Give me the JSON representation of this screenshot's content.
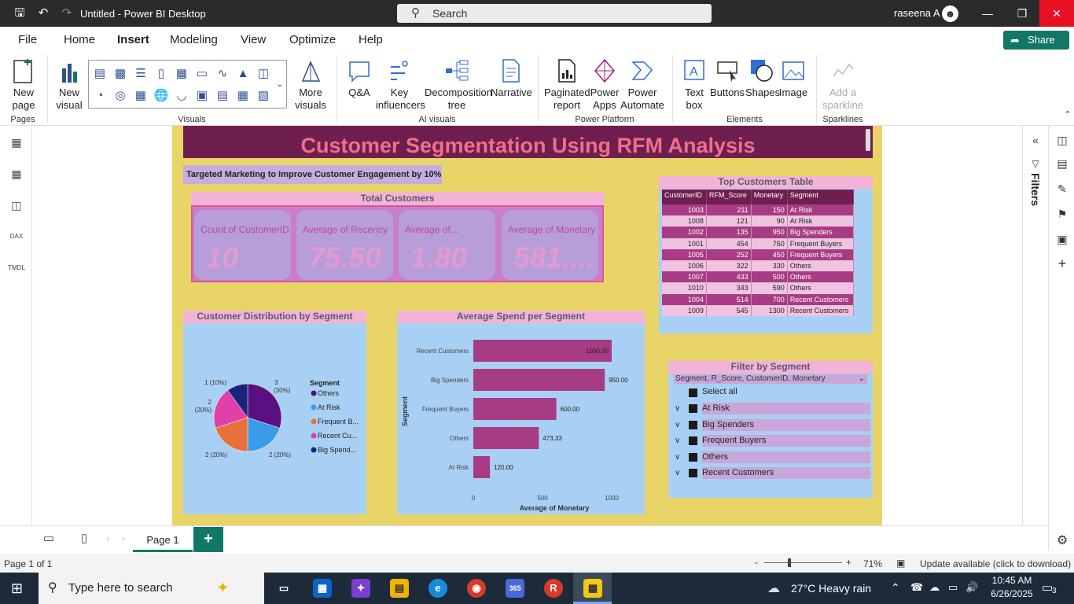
{
  "window": {
    "title": "Untitled - Power BI Desktop",
    "search_label": "Search",
    "user": "raseena A"
  },
  "menu": {
    "items": [
      "File",
      "Home",
      "Insert",
      "Modeling",
      "View",
      "Optimize",
      "Help"
    ],
    "active": "Insert",
    "share_label": "Share"
  },
  "ribbon": {
    "new_page": "New page",
    "new_visual": "New visual",
    "more_visuals": "More visuals",
    "qa": "Q&A",
    "key_influencers": "Key influencers",
    "decomposition_tree": "Decomposition tree",
    "narrative": "Narrative",
    "paginated_report": "Paginated report",
    "power_apps": "Power Apps",
    "power_automate": "Power Automate",
    "text_box": "Text box",
    "buttons": "Buttons",
    "shapes": "Shapes",
    "image": "Image",
    "add_sparkline": "Add a sparkline",
    "groups": {
      "pages": "Pages",
      "visuals": "Visuals",
      "ai_visuals": "AI visuals",
      "power_platform": "Power Platform",
      "elements": "Elements",
      "sparklines": "Sparklines"
    }
  },
  "report": {
    "title": "Customer Segmentation Using RFM Analysis",
    "subtitle": "Targeted Marketing to Improve Customer Engagement by 10%",
    "total_customers": {
      "header": "Total Customers",
      "cards": [
        {
          "label": "Count of CustomerID",
          "value": "10"
        },
        {
          "label": "Average of Recency",
          "value": "75.50"
        },
        {
          "label": "Average of...",
          "value": "1.80"
        },
        {
          "label": "Average of Monetary",
          "value": "581...."
        }
      ]
    },
    "top_table": {
      "header": "Top Customers Table",
      "columns": [
        "CustomerID",
        "RFM_Score",
        "Monetary",
        "Segment"
      ],
      "rows": [
        [
          "1003",
          "211",
          "150",
          "At Risk"
        ],
        [
          "1008",
          "121",
          "90",
          "At Risk"
        ],
        [
          "1002",
          "135",
          "950",
          "Big Spenders"
        ],
        [
          "1001",
          "454",
          "750",
          "Frequent Buyers"
        ],
        [
          "1005",
          "252",
          "450",
          "Frequent Buyers"
        ],
        [
          "1006",
          "322",
          "330",
          "Others"
        ],
        [
          "1007",
          "433",
          "500",
          "Others"
        ],
        [
          "1010",
          "343",
          "590",
          "Others"
        ],
        [
          "1004",
          "514",
          "700",
          "Recent Customers"
        ],
        [
          "1009",
          "545",
          "1300",
          "Recent Customers"
        ]
      ]
    },
    "pie": {
      "header": "Customer Distribution by Segment",
      "legend_title": "Segment",
      "legend": [
        "Others",
        "At Risk",
        "Frequent B...",
        "Recent Cu...",
        "Big Spend..."
      ],
      "labels": [
        "3 (30%)",
        "2 (20%)",
        "2 (20%)",
        "2 (20%)",
        "1 (10%)"
      ]
    },
    "bar": {
      "header": "Average Spend per Segment",
      "ylabel": "Segment",
      "xlabel": "Average of Monetary",
      "ticks": [
        "0",
        "500",
        "1000"
      ],
      "value_labels": [
        "1000.00",
        "950.00",
        "600.00",
        "473.33",
        "120.00"
      ]
    },
    "slicer": {
      "header": "Filter by Segment",
      "fields": "Segment, R_Score, CustomerID, Monetary",
      "select_all": "Select all",
      "items": [
        "At Risk",
        "Big Spenders",
        "Frequent Buyers",
        "Others",
        "Recent Customers"
      ]
    }
  },
  "chart_data": [
    {
      "type": "pie",
      "title": "Customer Distribution by Segment",
      "legend_title": "Segment",
      "categories": [
        "Others",
        "At Risk",
        "Frequent Buyers",
        "Recent Customers",
        "Big Spenders"
      ],
      "values": [
        3,
        2,
        2,
        2,
        1
      ],
      "colors": [
        "#5a1080",
        "#3a9be8",
        "#e8703a",
        "#e040a8",
        "#1a237e"
      ]
    },
    {
      "type": "bar",
      "title": "Average Spend per Segment",
      "xlabel": "Average of Monetary",
      "ylabel": "Segment",
      "categories": [
        "Recent Customers",
        "Big Spenders",
        "Frequent Buyers",
        "Others",
        "At Risk"
      ],
      "values": [
        1000.0,
        950.0,
        600.0,
        473.33,
        120.0
      ],
      "xlim": [
        0,
        1000
      ],
      "color": "#a83c84"
    }
  ],
  "sidepanel": {
    "filters_label": "Filters"
  },
  "pages": {
    "tab": "Page 1"
  },
  "status": {
    "page_info": "Page 1 of 1",
    "zoom": "71%",
    "update": "Update available (click to download)"
  },
  "taskbar": {
    "search_placeholder": "Type here to search",
    "weather": "27°C  Heavy rain",
    "time": "10:45 AM",
    "date": "6/26/2025",
    "notifications": "3"
  }
}
